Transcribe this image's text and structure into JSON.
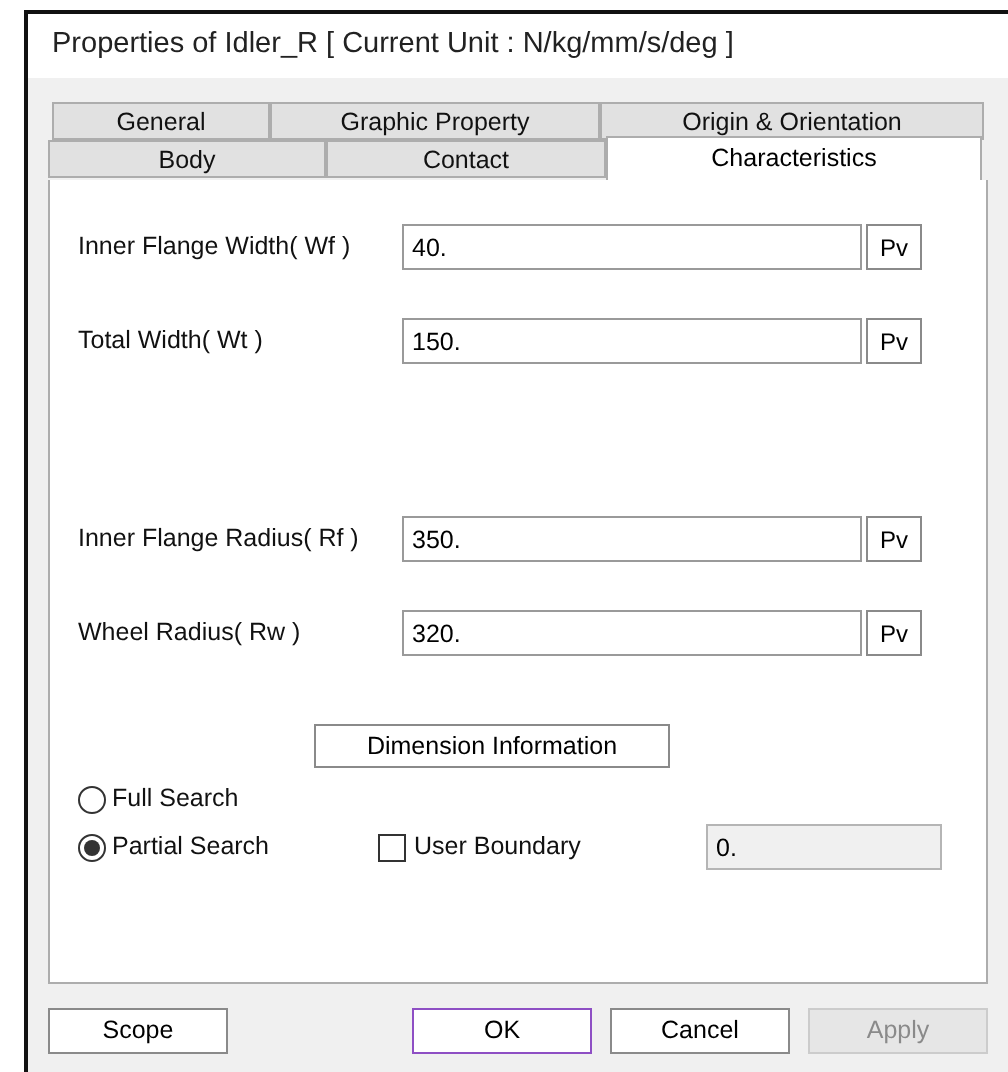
{
  "window": {
    "title": "Properties of Idler_R [ Current Unit : N/kg/mm/s/deg ]"
  },
  "tab_rows": [
    [
      {
        "label": "General",
        "selected": false
      },
      {
        "label": "Graphic Property",
        "selected": false
      },
      {
        "label": "Origin & Orientation",
        "selected": false
      }
    ],
    [
      {
        "label": "Body",
        "selected": false
      },
      {
        "label": "Contact",
        "selected": false
      },
      {
        "label": "Characteristics",
        "selected": true
      }
    ]
  ],
  "fields": [
    {
      "label": "Inner Flange Width( Wf )",
      "value": "40.",
      "button": "Pv"
    },
    {
      "label": "Total Width( Wt )",
      "value": "150.",
      "button": "Pv"
    },
    {
      "label": "Inner Flange Radius( Rf )",
      "value": "350.",
      "button": "Pv"
    },
    {
      "label": "Wheel Radius( Rw )",
      "value": "320.",
      "button": "Pv"
    }
  ],
  "dimension_button": "Dimension Information",
  "search_options": [
    {
      "label": "Full Search",
      "selected": false
    },
    {
      "label": "Partial Search",
      "selected": true
    }
  ],
  "user_boundary": {
    "label": "User Boundary",
    "checked": false,
    "value": "0.",
    "disabled": true
  },
  "buttons": [
    {
      "label": "Scope",
      "disabled": false,
      "focused": false
    },
    {
      "label": "OK",
      "disabled": false,
      "focused": true
    },
    {
      "label": "Cancel",
      "disabled": false,
      "focused": false
    },
    {
      "label": "Apply",
      "disabled": true,
      "focused": false
    }
  ]
}
